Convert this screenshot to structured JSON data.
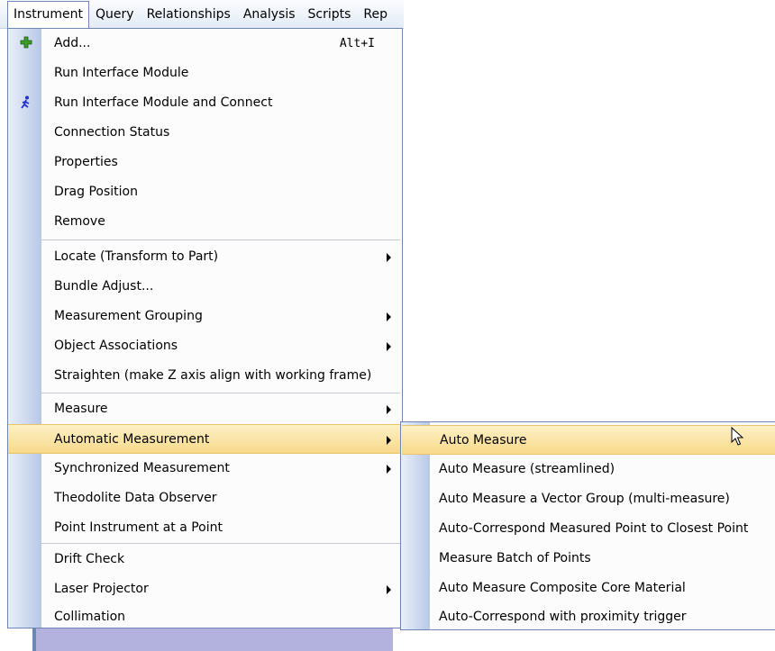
{
  "menubar": {
    "items": [
      "Instrument",
      "Query",
      "Relationships",
      "Analysis",
      "Scripts",
      "Rep"
    ]
  },
  "menu": {
    "items": [
      {
        "label": "Add...",
        "shortcut": "Alt+I",
        "icon": "add-plus-icon"
      },
      {
        "label": "Run Interface Module"
      },
      {
        "label": "Run Interface Module and Connect",
        "icon": "running-man-icon"
      },
      {
        "label": "Connection Status"
      },
      {
        "label": "Properties"
      },
      {
        "label": "Drag Position"
      },
      {
        "label": "Remove"
      },
      {
        "label": "Locate (Transform to Part)",
        "submenu": true
      },
      {
        "label": "Bundle Adjust..."
      },
      {
        "label": "Measurement Grouping",
        "submenu": true
      },
      {
        "label": "Object Associations",
        "submenu": true
      },
      {
        "label": "Straighten (make Z axis align with working frame)"
      },
      {
        "label": "Measure",
        "submenu": true
      },
      {
        "label": "Automatic Measurement",
        "submenu": true,
        "highlighted": true
      },
      {
        "label": "Synchronized Measurement",
        "submenu": true
      },
      {
        "label": "Theodolite Data Observer"
      },
      {
        "label": "Point Instrument at a Point"
      },
      {
        "label": "Drift Check"
      },
      {
        "label": "Laser Projector",
        "submenu": true
      },
      {
        "label": "Collimation"
      }
    ]
  },
  "submenu": {
    "items": [
      {
        "label": "Auto Measure",
        "highlighted": true
      },
      {
        "label": "Auto Measure (streamlined)"
      },
      {
        "label": "Auto Measure a Vector Group (multi-measure)"
      },
      {
        "label": "Auto-Correspond Measured Point to Closest Point"
      },
      {
        "label": "Measure Batch of Points"
      },
      {
        "label": "Auto Measure Composite Core Material"
      },
      {
        "label": "Auto-Correspond with proximity trigger"
      }
    ]
  },
  "colors": {
    "highlight": "#f7d98a",
    "border": "#6d87b5",
    "gutter": "#b8c8e6"
  }
}
